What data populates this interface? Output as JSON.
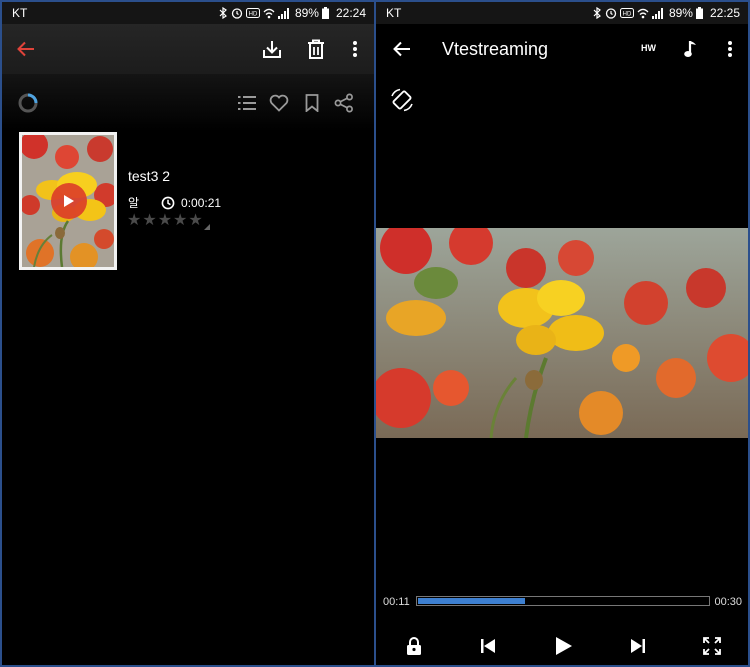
{
  "left": {
    "status": {
      "carrier": "KT",
      "battery": "89%",
      "time": "22:24"
    },
    "file": {
      "title": "test3 2",
      "badge": "알",
      "duration": "0:00:21",
      "rating": 0
    }
  },
  "right": {
    "status": {
      "carrier": "KT",
      "battery": "89%",
      "time": "22:25"
    },
    "title": "Vtestreaming",
    "hw_label": "HW",
    "time_current": "00:11",
    "time_total": "00:30",
    "progress": 0.37
  },
  "colors": {
    "accent_back": "#e0433a",
    "progress": "#3d7fd0",
    "frame": "#2b4f8c"
  }
}
